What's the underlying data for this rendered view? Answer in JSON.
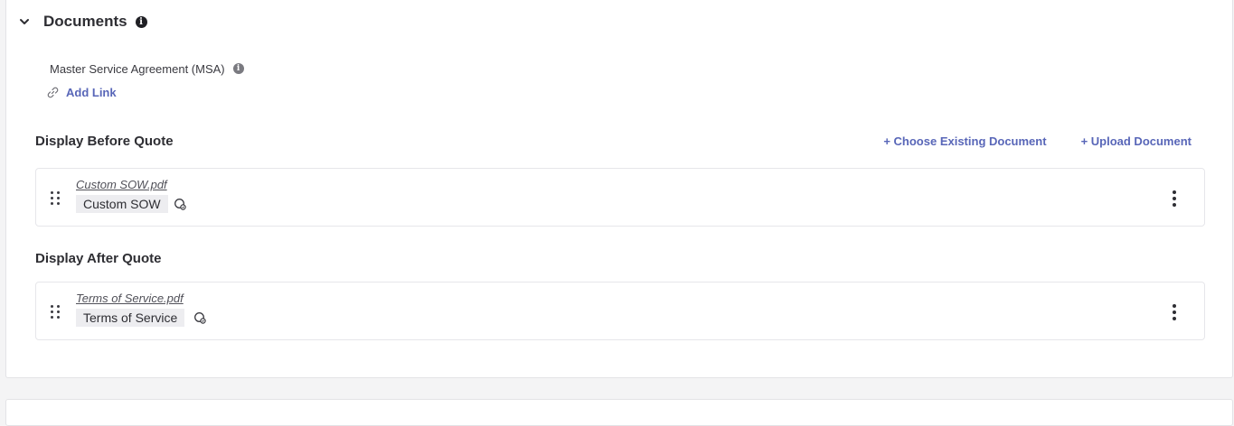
{
  "section": {
    "title": "Documents",
    "info_icon": "info-icon"
  },
  "msa": {
    "label": "Master Service Agreement (MSA)",
    "add_link_label": "Add Link"
  },
  "before_quote": {
    "title": "Display Before Quote",
    "choose_existing_label": "+ Choose Existing Document",
    "upload_label": "+ Upload Document",
    "documents": [
      {
        "file_name": "Custom SOW.pdf",
        "tag": "Custom SOW"
      }
    ]
  },
  "after_quote": {
    "title": "Display After Quote",
    "documents": [
      {
        "file_name": "Terms of Service.pdf",
        "tag": "Terms of Service"
      }
    ]
  },
  "colors": {
    "accent": "#5866b8",
    "text": "#2e2e33",
    "tag_bg": "#ededf0",
    "border": "#e6e6ea"
  }
}
